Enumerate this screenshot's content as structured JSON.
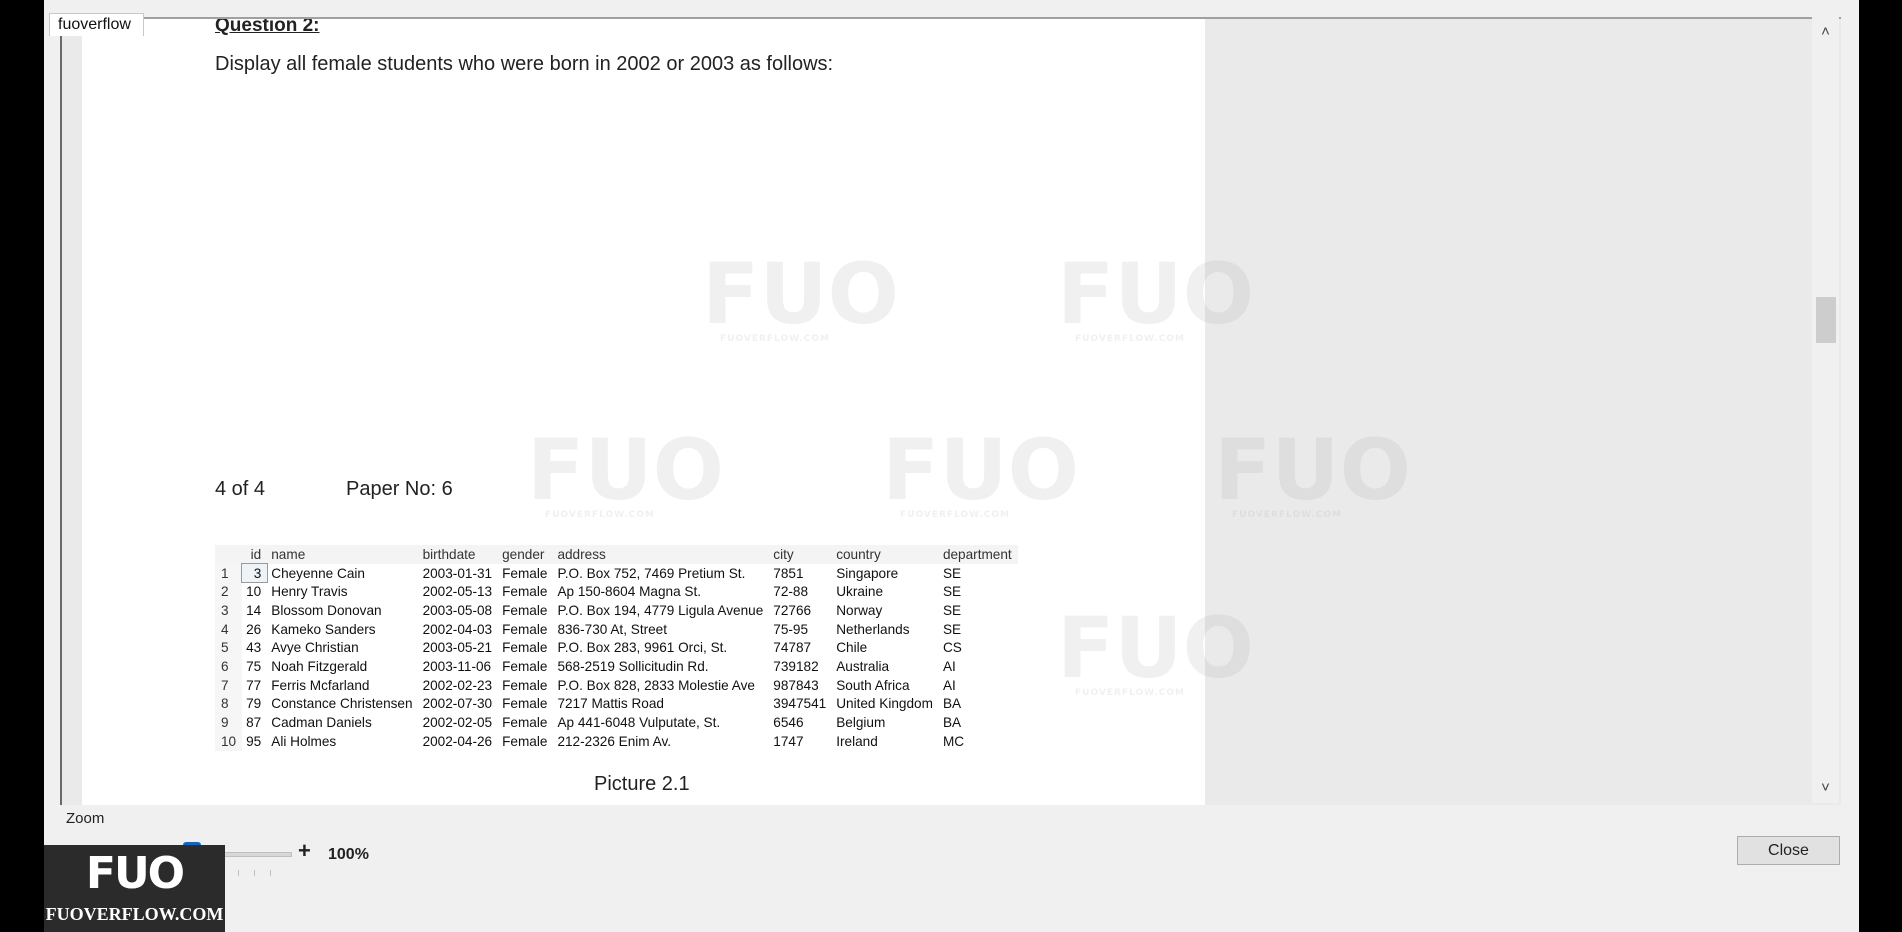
{
  "document_tab": "fuoverflow",
  "question": {
    "title": "Question 2:",
    "text": "Display all female students who were born in 2002 or 2003 as follows:"
  },
  "page_info": {
    "page": "4 of 4",
    "paper": "Paper No: 6"
  },
  "table": {
    "columns": [
      "",
      "id",
      "name",
      "birthdate",
      "gender",
      "address",
      "city",
      "country",
      "department"
    ],
    "rows": [
      [
        "1",
        "3",
        "Cheyenne Cain",
        "2003-01-31",
        "Female",
        "P.O. Box 752, 7469 Pretium St.",
        "7851",
        "Singapore",
        "SE"
      ],
      [
        "2",
        "10",
        "Henry Travis",
        "2002-05-13",
        "Female",
        "Ap 150-8604 Magna St.",
        "72-88",
        "Ukraine",
        "SE"
      ],
      [
        "3",
        "14",
        "Blossom Donovan",
        "2003-05-08",
        "Female",
        "P.O. Box 194, 4779 Ligula Avenue",
        "72766",
        "Norway",
        "SE"
      ],
      [
        "4",
        "26",
        "Kameko Sanders",
        "2002-04-03",
        "Female",
        "836-730 At, Street",
        "75-95",
        "Netherlands",
        "SE"
      ],
      [
        "5",
        "43",
        "Avye Christian",
        "2003-05-21",
        "Female",
        "P.O. Box 283, 9961 Orci, St.",
        "74787",
        "Chile",
        "CS"
      ],
      [
        "6",
        "75",
        "Noah Fitzgerald",
        "2003-11-06",
        "Female",
        "568-2519 Sollicitudin Rd.",
        "739182",
        "Australia",
        "AI"
      ],
      [
        "7",
        "77",
        "Ferris Mcfarland",
        "2002-02-23",
        "Female",
        "P.O. Box 828, 2833 Molestie Ave",
        "987843",
        "South Africa",
        "AI"
      ],
      [
        "8",
        "79",
        "Constance Christensen",
        "2002-07-30",
        "Female",
        "7217 Mattis Road",
        "3947541",
        "United Kingdom",
        "BA"
      ],
      [
        "9",
        "87",
        "Cadman Daniels",
        "2002-02-05",
        "Female",
        "Ap 441-6048 Vulputate, St.",
        "6546",
        "Belgium",
        "BA"
      ],
      [
        "10",
        "95",
        "Ali Holmes",
        "2002-04-26",
        "Female",
        "212-2326 Enim Av.",
        "1747",
        "Ireland",
        "MC"
      ]
    ]
  },
  "caption": "Picture 2.1",
  "zoom": {
    "label": "Zoom",
    "minus": "-",
    "plus": "+",
    "value": "100%"
  },
  "close_label": "Close",
  "scroll_up": "˄",
  "scroll_down": "˅",
  "watermark": {
    "mark": "FUO",
    "text": "FUOVERFLOW.COM"
  },
  "brand": {
    "mark": "FUO",
    "text": "FUOVERFLOW.COM"
  }
}
